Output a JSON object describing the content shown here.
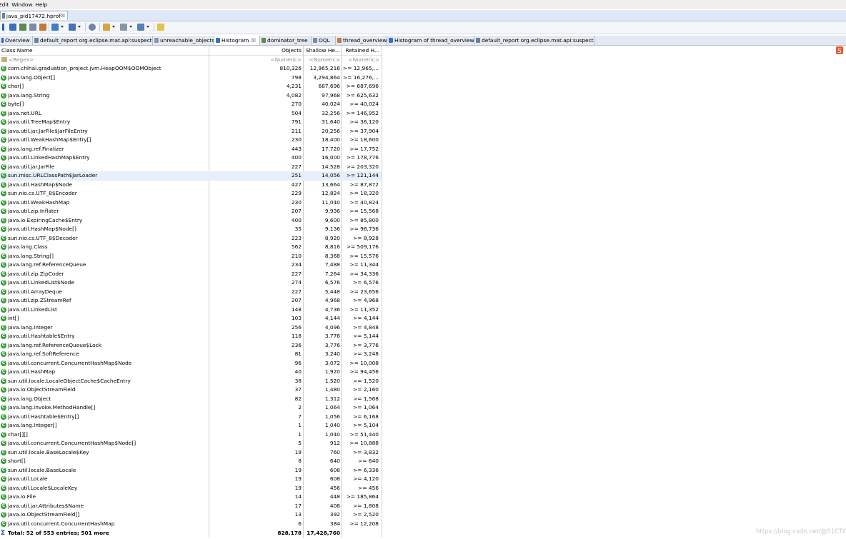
{
  "menu": [
    "Edit",
    "Window",
    "Help"
  ],
  "editor_tab": {
    "label": "java_pid17472.hprof",
    "close": "☒"
  },
  "view_tabs": [
    {
      "label": "Overview",
      "active": false
    },
    {
      "label": "default_report  org.eclipse.mat.api:suspects",
      "active": false
    },
    {
      "label": "unreachable_objects",
      "active": false
    },
    {
      "label": "Histogram",
      "active": true
    },
    {
      "label": "dominator_tree",
      "active": false
    },
    {
      "label": "OQL",
      "active": false
    },
    {
      "label": "thread_overview",
      "active": false
    },
    {
      "label": "Histogram of thread_overview",
      "active": false
    },
    {
      "label": "default_report  org.eclipse.mat.api:suspects",
      "active": false
    }
  ],
  "columns": {
    "name": "Class Name",
    "objects": "Objects",
    "shallow": "Shallow He...",
    "retained": "Retained H..."
  },
  "filters": {
    "name": "<Regex>",
    "objects": "<Numeric>",
    "shallow": "<Numeric>",
    "retained": "<Numeric>"
  },
  "rows": [
    {
      "name": "com.chihai.graduation_project.jvm.HeapOOM$OOMObject",
      "objects": "810,326",
      "shallow": "12,965,216",
      "retained": ">= 12,965,..."
    },
    {
      "name": "java.lang.Object[]",
      "objects": "798",
      "shallow": "3,294,864",
      "retained": ">= 16,276,..."
    },
    {
      "name": "char[]",
      "objects": "4,231",
      "shallow": "687,696",
      "retained": ">= 687,696"
    },
    {
      "name": "java.lang.String",
      "objects": "4,082",
      "shallow": "97,968",
      "retained": ">= 625,632"
    },
    {
      "name": "byte[]",
      "objects": "270",
      "shallow": "40,024",
      "retained": ">= 40,024"
    },
    {
      "name": "java.net.URL",
      "objects": "504",
      "shallow": "32,256",
      "retained": ">= 146,952"
    },
    {
      "name": "java.util.TreeMap$Entry",
      "objects": "791",
      "shallow": "31,640",
      "retained": ">= 36,120"
    },
    {
      "name": "java.util.jar.JarFile$JarFileEntry",
      "objects": "211",
      "shallow": "20,256",
      "retained": ">= 37,904"
    },
    {
      "name": "java.util.WeakHashMap$Entry[]",
      "objects": "230",
      "shallow": "18,400",
      "retained": ">= 18,600"
    },
    {
      "name": "java.lang.ref.Finalizer",
      "objects": "443",
      "shallow": "17,720",
      "retained": ">= 17,752"
    },
    {
      "name": "java.util.LinkedHashMap$Entry",
      "objects": "400",
      "shallow": "16,000",
      "retained": ">= 178,776"
    },
    {
      "name": "java.util.jar.JarFile",
      "objects": "227",
      "shallow": "14,528",
      "retained": ">= 203,320"
    },
    {
      "name": "sun.misc.URLClassPath$JarLoader",
      "objects": "251",
      "shallow": "14,056",
      "retained": ">= 121,144",
      "selected": true
    },
    {
      "name": "java.util.HashMap$Node",
      "objects": "427",
      "shallow": "13,664",
      "retained": ">= 87,872"
    },
    {
      "name": "sun.nio.cs.UTF_8$Encoder",
      "objects": "229",
      "shallow": "12,824",
      "retained": ">= 18,320"
    },
    {
      "name": "java.util.WeakHashMap",
      "objects": "230",
      "shallow": "11,040",
      "retained": ">= 40,824"
    },
    {
      "name": "java.util.zip.Inflater",
      "objects": "207",
      "shallow": "9,936",
      "retained": ">= 15,568"
    },
    {
      "name": "java.io.ExpiringCache$Entry",
      "objects": "400",
      "shallow": "9,600",
      "retained": ">= 85,800"
    },
    {
      "name": "java.util.HashMap$Node[]",
      "objects": "35",
      "shallow": "9,136",
      "retained": ">= 96,736"
    },
    {
      "name": "sun.nio.cs.UTF_8$Decoder",
      "objects": "223",
      "shallow": "8,920",
      "retained": ">= 8,928"
    },
    {
      "name": "java.lang.Class",
      "objects": "562",
      "shallow": "8,816",
      "retained": ">= 509,176"
    },
    {
      "name": "java.lang.String[]",
      "objects": "210",
      "shallow": "8,368",
      "retained": ">= 15,576"
    },
    {
      "name": "java.lang.ref.ReferenceQueue",
      "objects": "234",
      "shallow": "7,488",
      "retained": ">= 11,344"
    },
    {
      "name": "java.util.zip.ZipCoder",
      "objects": "227",
      "shallow": "7,264",
      "retained": ">= 34,336"
    },
    {
      "name": "java.util.LinkedList$Node",
      "objects": "274",
      "shallow": "6,576",
      "retained": ">= 6,576"
    },
    {
      "name": "java.util.ArrayDeque",
      "objects": "227",
      "shallow": "5,448",
      "retained": ">= 23,656"
    },
    {
      "name": "java.util.zip.ZStreamRef",
      "objects": "207",
      "shallow": "4,968",
      "retained": ">= 4,968"
    },
    {
      "name": "java.util.LinkedList",
      "objects": "148",
      "shallow": "4,736",
      "retained": ">= 11,352"
    },
    {
      "name": "int[]",
      "objects": "103",
      "shallow": "4,144",
      "retained": ">= 4,144"
    },
    {
      "name": "java.lang.Integer",
      "objects": "256",
      "shallow": "4,096",
      "retained": ">= 4,848"
    },
    {
      "name": "java.util.Hashtable$Entry",
      "objects": "118",
      "shallow": "3,776",
      "retained": ">= 5,144"
    },
    {
      "name": "java.lang.ref.ReferenceQueue$Lock",
      "objects": "236",
      "shallow": "3,776",
      "retained": ">= 3,776"
    },
    {
      "name": "java.lang.ref.SoftReference",
      "objects": "81",
      "shallow": "3,240",
      "retained": ">= 3,248"
    },
    {
      "name": "java.util.concurrent.ConcurrentHashMap$Node",
      "objects": "96",
      "shallow": "3,072",
      "retained": ">= 10,008"
    },
    {
      "name": "java.util.HashMap",
      "objects": "40",
      "shallow": "1,920",
      "retained": ">= 94,456"
    },
    {
      "name": "sun.util.locale.LocaleObjectCache$CacheEntry",
      "objects": "38",
      "shallow": "1,520",
      "retained": ">= 1,520"
    },
    {
      "name": "java.io.ObjectStreamField",
      "objects": "37",
      "shallow": "1,480",
      "retained": ">= 2,160"
    },
    {
      "name": "java.lang.Object",
      "objects": "82",
      "shallow": "1,312",
      "retained": ">= 1,568"
    },
    {
      "name": "java.lang.invoke.MethodHandle[]",
      "objects": "2",
      "shallow": "1,064",
      "retained": ">= 1,064"
    },
    {
      "name": "java.util.Hashtable$Entry[]",
      "objects": "7",
      "shallow": "1,056",
      "retained": ">= 6,168"
    },
    {
      "name": "java.lang.Integer[]",
      "objects": "1",
      "shallow": "1,040",
      "retained": ">= 5,104"
    },
    {
      "name": "char[][]",
      "objects": "1",
      "shallow": "1,040",
      "retained": ">= 51,440"
    },
    {
      "name": "java.util.concurrent.ConcurrentHashMap$Node[]",
      "objects": "5",
      "shallow": "912",
      "retained": ">= 10,888"
    },
    {
      "name": "sun.util.locale.BaseLocale$Key",
      "objects": "19",
      "shallow": "760",
      "retained": ">= 3,832"
    },
    {
      "name": "short[]",
      "objects": "8",
      "shallow": "640",
      "retained": ">= 640"
    },
    {
      "name": "sun.util.locale.BaseLocale",
      "objects": "19",
      "shallow": "608",
      "retained": ">= 6,336"
    },
    {
      "name": "java.util.Locale",
      "objects": "19",
      "shallow": "608",
      "retained": ">= 4,120"
    },
    {
      "name": "java.util.Locale$LocaleKey",
      "objects": "19",
      "shallow": "456",
      "retained": ">= 456"
    },
    {
      "name": "java.io.File",
      "objects": "14",
      "shallow": "448",
      "retained": ">= 185,864"
    },
    {
      "name": "java.util.jar.Attributes$Name",
      "objects": "17",
      "shallow": "408",
      "retained": ">= 1,808"
    },
    {
      "name": "java.io.ObjectStreamField[]",
      "objects": "13",
      "shallow": "392",
      "retained": ">= 2,520"
    },
    {
      "name": "java.util.concurrent.ConcurrentHashMap",
      "objects": "6",
      "shallow": "384",
      "retained": ">= 12,208"
    }
  ],
  "total": {
    "label": "Total: 52 of 553 entries; 501 more",
    "objects": "828,178",
    "shallow": "17,428,760"
  },
  "watermark": "https://blog.csdn.net/@51CTO博客",
  "class_icon": "class-icon",
  "colors": {
    "class_icon": "#3d9a3d",
    "selected_row": "#e7f0fa",
    "tab_bar": "#dfe8f6"
  }
}
